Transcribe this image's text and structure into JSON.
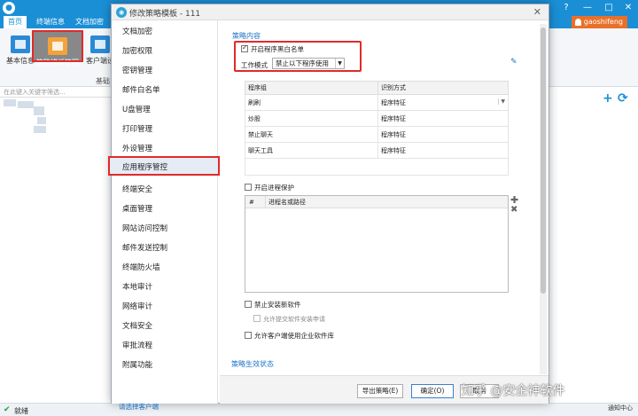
{
  "main_window": {
    "tabs": [
      "首页",
      "终端信息",
      "文档加密"
    ],
    "user": "gaoshifeng",
    "ribbon": {
      "basic_info": "基本信息",
      "template": "策略模板管理",
      "client": "客户端设",
      "group_label": "基础"
    },
    "search_placeholder": "在此键入关键字筛选...",
    "status": "就绪",
    "notify": "通知中心"
  },
  "dialog": {
    "title": "修改策略模板 - 111",
    "nav_items": [
      "文档加密",
      "加密权限",
      "密钥管理",
      "邮件白名单",
      "U盘管理",
      "打印管理",
      "外设管理",
      "应用程序管控",
      "终端安全",
      "桌面管理",
      "网站访问控制",
      "邮件发送控制",
      "终端防火墙",
      "本地审计",
      "网络审计",
      "文档安全",
      "审批流程",
      "附属功能"
    ],
    "active_nav": "应用程序管控",
    "select_client": "请选择客户端",
    "strategy_content": "策略内容",
    "enable_blacklist": "开启程序黑白名单",
    "work_mode_label": "工作模式",
    "work_mode_value": "禁止以下程序使用",
    "program_table": {
      "headers": [
        "程序组",
        "识别方式"
      ],
      "rows": [
        {
          "group": "刷刷",
          "method": "程序特征"
        },
        {
          "group": "炒股",
          "method": "程序特征"
        },
        {
          "group": "禁止聊天",
          "method": "程序特征"
        },
        {
          "group": "聊天工具",
          "method": "程序特征"
        }
      ]
    },
    "process_protect": "开启进程保护",
    "process_table": {
      "col_num": "#",
      "col_name": "进程名或路径"
    },
    "ban_install": "禁止安装新软件",
    "allow_submit": "允许提交软件安装申请",
    "allow_client_lib": "允许客户端使用企业软件库",
    "effect_status": "策略生效状态",
    "buttons": {
      "export": "导出策略(E)",
      "ok": "确定(O)",
      "cancel": "取消"
    }
  },
  "watermark": "知乎 @安企神软件",
  "colors": {
    "accent": "#1a8fd6",
    "highlight": "#e02a2a",
    "link": "#1a73c8"
  }
}
